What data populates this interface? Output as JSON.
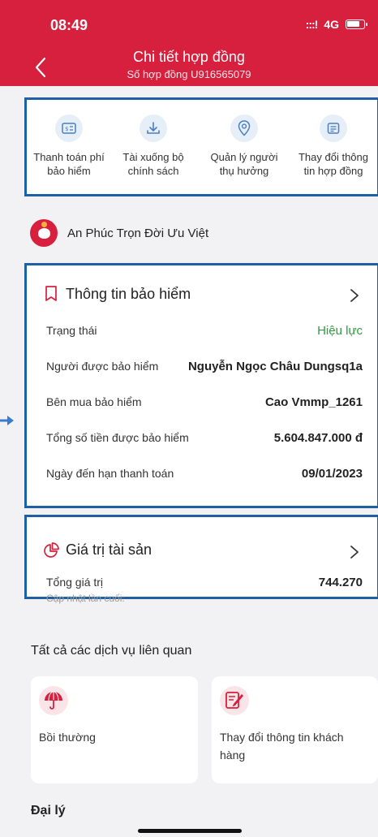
{
  "status_bar": {
    "time": "08:49",
    "signal": ":::!",
    "network": "4G"
  },
  "header": {
    "title": "Chi tiết hợp đồng",
    "subtitle": "Số hợp đồng U916565079"
  },
  "quick_actions": [
    {
      "line1": "Thanh toán phí",
      "line2": "bảo hiểm",
      "icon": "payment-icon"
    },
    {
      "line1": "Tài xuống bộ",
      "line2": "chính sách",
      "icon": "download-icon"
    },
    {
      "line1": "Quản lý người",
      "line2": "thụ hưởng",
      "icon": "location-pin-icon"
    },
    {
      "line1": "Thay đổi thông",
      "line2": "tin hợp đồng",
      "icon": "document-icon"
    }
  ],
  "product": {
    "name": "An Phúc Trọn Đời Ưu Việt"
  },
  "insurance_info": {
    "title": "Thông tin bảo hiểm",
    "rows": [
      {
        "label": "Trạng thái",
        "value": "Hiệu lực"
      },
      {
        "label": "Người được bảo hiểm",
        "value": "Nguyễn Ngọc Châu Dungsq1a"
      },
      {
        "label": "Bên mua bảo hiểm",
        "value": "Cao Vmmp_1261"
      },
      {
        "label": "Tổng số tiền được bảo hiểm",
        "value": "5.604.847.000 đ"
      },
      {
        "label": "Ngày đến hạn thanh toán",
        "value": "09/01/2023"
      }
    ]
  },
  "asset_value": {
    "title": "Giá trị tài sản",
    "label": "Tổng giá trị",
    "value": "744.270",
    "updated_label": "Cập nhật lần cuối:"
  },
  "services": {
    "title": "Tất cả các dịch vụ liên quan",
    "items": [
      {
        "line1": "Bồi thường",
        "line2": "",
        "icon": "umbrella-icon"
      },
      {
        "line1": "Thay đổi thông tin khách",
        "line2": "hàng",
        "icon": "edit-document-icon"
      }
    ]
  },
  "agent": {
    "title": "Đại lý"
  },
  "colors": {
    "brand": "#d6203d",
    "highlight_border": "#1f5fa3",
    "status_active": "#2e9a3e",
    "icon_blue": "#4a7fc1"
  }
}
